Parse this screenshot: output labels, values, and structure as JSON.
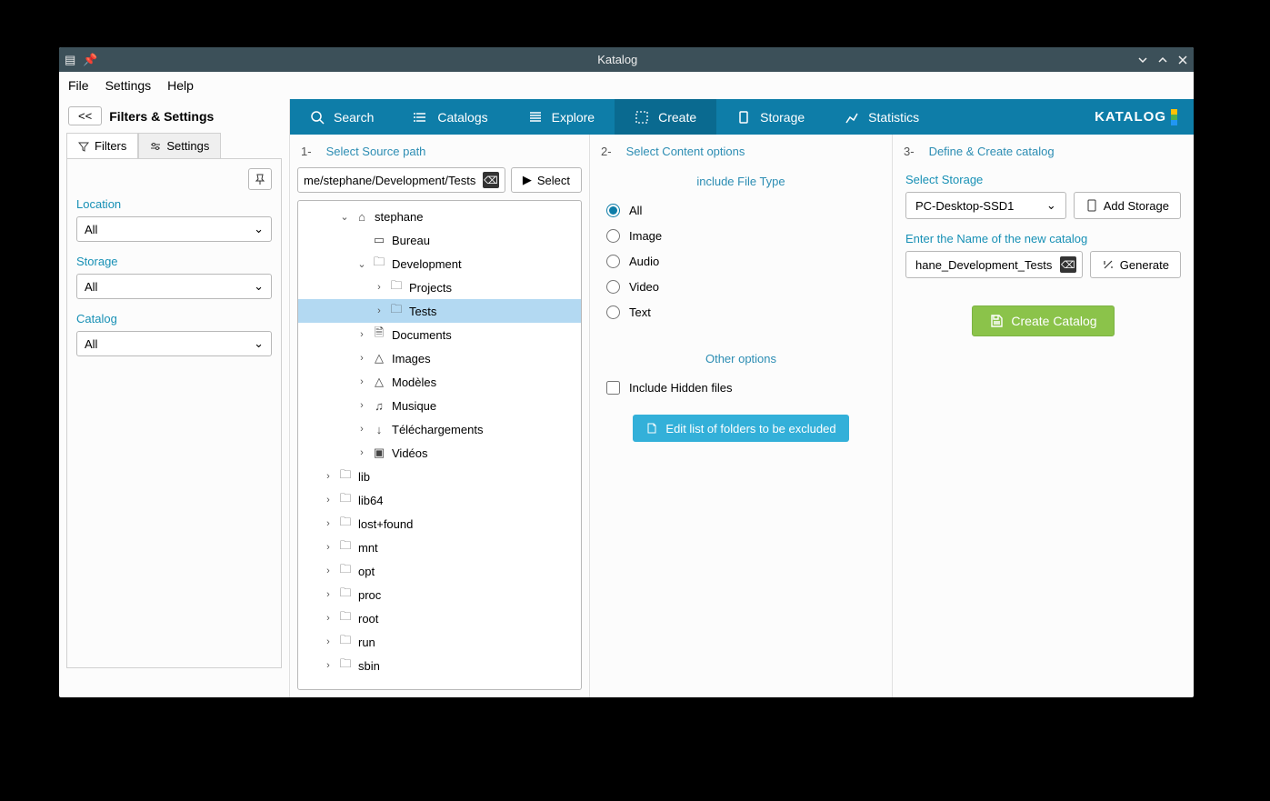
{
  "window": {
    "title": "Katalog"
  },
  "menu": {
    "file": "File",
    "settings": "Settings",
    "help": "Help"
  },
  "sidebar": {
    "collapse": "<<",
    "title": "Filters & Settings",
    "tabs": {
      "filters": "Filters",
      "settings": "Settings"
    },
    "groups": [
      {
        "label": "Location",
        "value": "All"
      },
      {
        "label": "Storage",
        "value": "All"
      },
      {
        "label": "Catalog",
        "value": "All"
      }
    ]
  },
  "mainTabs": {
    "search": "Search",
    "catalogs": "Catalogs",
    "explore": "Explore",
    "create": "Create",
    "storage": "Storage",
    "statistics": "Statistics",
    "brand": "KATALOG"
  },
  "col1": {
    "num": "1-",
    "title": "Select Source path",
    "path": "me/stephane/Development/Tests",
    "select": "Select",
    "tree": {
      "stephane": "stephane",
      "bureau": "Bureau",
      "development": "Development",
      "projects": "Projects",
      "tests": "Tests",
      "documents": "Documents",
      "images": "Images",
      "modeles": "Modèles",
      "musique": "Musique",
      "telechargements": "Téléchargements",
      "videos": "Vidéos",
      "lib": "lib",
      "lib64": "lib64",
      "lostfound": "lost+found",
      "mnt": "mnt",
      "opt": "opt",
      "proc": "proc",
      "root": "root",
      "run": "run",
      "sbin": "sbin"
    }
  },
  "col2": {
    "num": "2-",
    "title": "Select Content options",
    "fileTypeTitle": "include File Type",
    "types": {
      "all": "All",
      "image": "Image",
      "audio": "Audio",
      "video": "Video",
      "text": "Text"
    },
    "otherTitle": "Other options",
    "hidden": "Include Hidden files",
    "editExcluded": "Edit list of folders to be excluded"
  },
  "col3": {
    "num": "3-",
    "title": "Define & Create catalog",
    "selectStorage": "Select Storage",
    "storageValue": "PC-Desktop-SSD1",
    "addStorage": "Add Storage",
    "nameLabel": "Enter the Name of the new catalog",
    "nameValue": "hane_Development_Tests",
    "generate": "Generate",
    "create": "Create Catalog"
  }
}
